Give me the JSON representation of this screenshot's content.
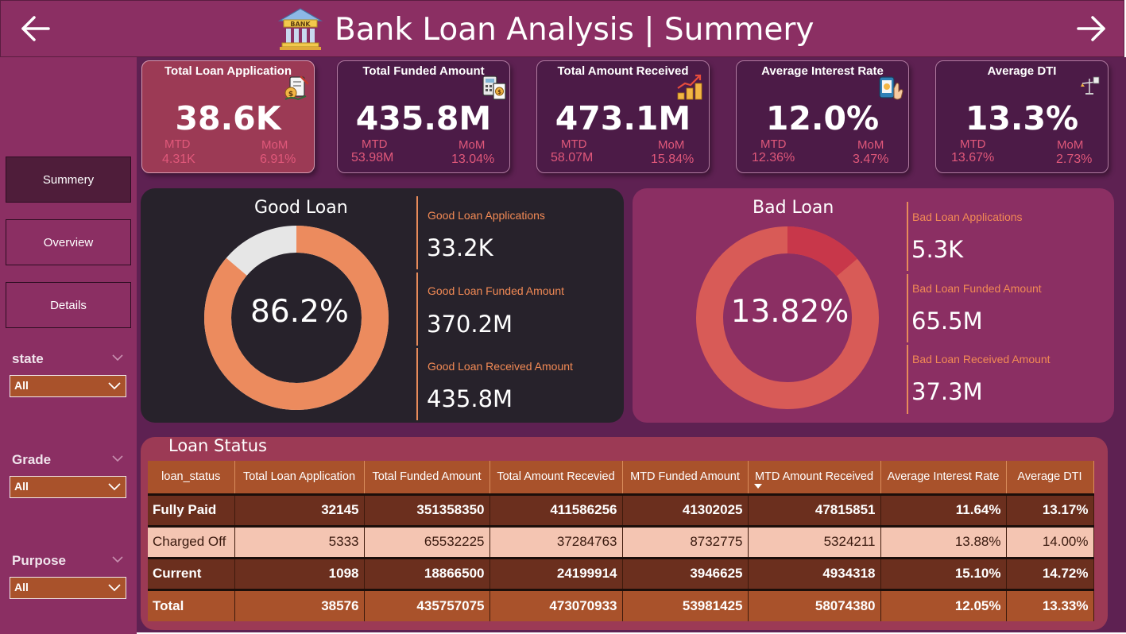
{
  "header": {
    "title": "Bank Loan Analysis | Summery",
    "bank_icon_label": "BANK",
    "back_icon": "arrow-left-icon",
    "forward_icon": "arrow-right-icon"
  },
  "nav": {
    "items": [
      {
        "label": "Summery",
        "active": true
      },
      {
        "label": "Overview",
        "active": false
      },
      {
        "label": "Details",
        "active": false
      }
    ]
  },
  "filters": [
    {
      "label": "state",
      "value": "All"
    },
    {
      "label": "Grade",
      "value": "All"
    },
    {
      "label": "Purpose",
      "value": "All"
    }
  ],
  "kpis": [
    {
      "title": "Total Loan Application",
      "value": "38.6K",
      "mtd_label": "MTD",
      "mtd": "4.31K",
      "mom_label": "MoM",
      "mom": "6.91%",
      "icon": "loan-application-icon"
    },
    {
      "title": "Total Funded Amount",
      "value": "435.8M",
      "mtd_label": "MTD",
      "mtd": "53.98M",
      "mom_label": "MoM",
      "mom": "13.04%",
      "icon": "funding-calculator-icon"
    },
    {
      "title": "Total Amount Received",
      "value": "473.1M",
      "mtd_label": "MTD",
      "mtd": "58.07M",
      "mom_label": "MoM",
      "mom": "15.84%",
      "icon": "growth-coins-icon"
    },
    {
      "title": "Average Interest Rate",
      "value": "12.0%",
      "mtd_label": "MTD",
      "mtd": "12.36%",
      "mom_label": "MoM",
      "mom": "3.47%",
      "icon": "mobile-payment-icon"
    },
    {
      "title": "Average DTI",
      "value": "13.3%",
      "mtd_label": "MTD",
      "mtd": "13.67%",
      "mom_label": "MoM",
      "mom": "2.73%",
      "icon": "balance-scale-icon"
    }
  ],
  "good_loan": {
    "title": "Good Loan",
    "percent_label": "86.2%",
    "percent": 86.2,
    "stats": [
      {
        "label": "Good Loan Applications",
        "value": "33.2K"
      },
      {
        "label": "Good Loan Funded Amount",
        "value": "370.2M"
      },
      {
        "label": "Good Loan Received Amount",
        "value": "435.8M"
      }
    ],
    "colors": {
      "main": "#ec8b5e",
      "rest": "#e6e6e6"
    }
  },
  "bad_loan": {
    "title": "Bad Loan",
    "percent_label": "13.82%",
    "percent": 13.82,
    "stats": [
      {
        "label": "Bad Loan Applications",
        "value": "5.3K"
      },
      {
        "label": "Bad Loan Funded Amount",
        "value": "65.5M"
      },
      {
        "label": "Bad Loan Received Amount",
        "value": "37.3M"
      }
    ],
    "colors": {
      "main": "#c8374a",
      "rest": "#d85b57"
    }
  },
  "loan_status": {
    "title": "Loan Status",
    "columns": [
      "loan_status",
      "Total Loan Application",
      "Total Funded Amount",
      "Total Amount Recevied",
      "MTD Funded Amount",
      "MTD Amount Received",
      "Average Interest Rate",
      "Average DTI"
    ],
    "sorted_column": "MTD Amount Received",
    "rows": [
      [
        "Fully Paid",
        "32145",
        "351358350",
        "411586256",
        "41302025",
        "47815851",
        "11.64%",
        "13.17%"
      ],
      [
        "Charged Off",
        "5333",
        "65532225",
        "37284763",
        "8732775",
        "5324211",
        "13.88%",
        "14.00%"
      ],
      [
        "Current",
        "1098",
        "18866500",
        "24199914",
        "3946625",
        "4934318",
        "15.10%",
        "14.72%"
      ]
    ],
    "total": [
      "Total",
      "38576",
      "435757075",
      "473070933",
      "53981425",
      "58074380",
      "12.05%",
      "13.33%"
    ]
  },
  "colors": {
    "header_bg": "#8b2f63",
    "canvas_bg": "#5e2152",
    "accent_orange": "#a9522b",
    "kpi_red": "#e0587a"
  }
}
